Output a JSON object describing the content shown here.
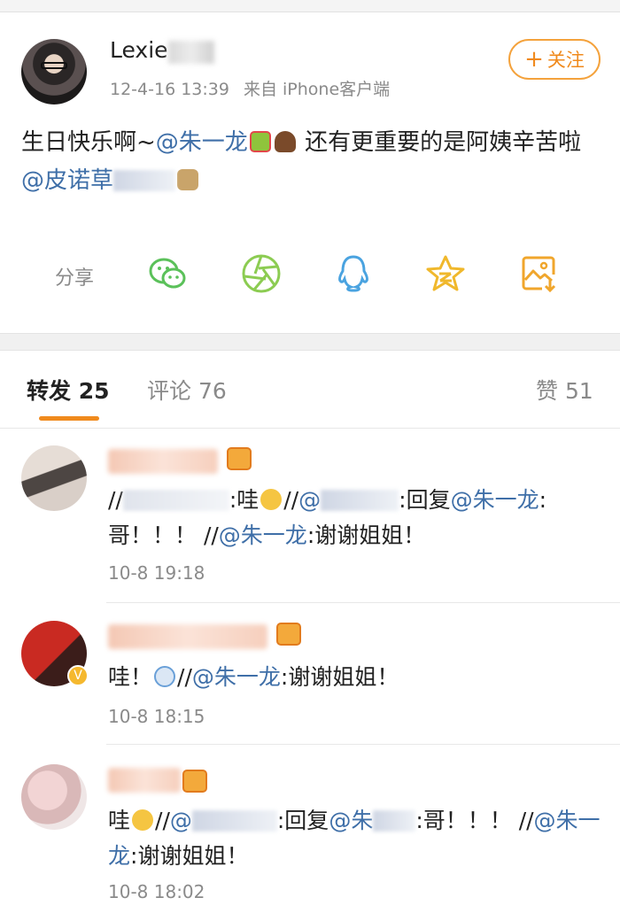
{
  "post": {
    "author": "Lexie",
    "time": "12-4-16 13:39",
    "source": "来自 iPhone客户端",
    "follow_label": "关注",
    "content_part1": "生日快乐啊~",
    "mention1": "@朱一龙",
    "content_part2": " 还有更重要的是阿姨辛苦啦",
    "mention2": "@皮诺草"
  },
  "share": {
    "label": "分享",
    "icons": [
      "wechat-icon",
      "moments-icon",
      "qq-icon",
      "qzone-icon",
      "save-image-icon"
    ]
  },
  "tabs": {
    "repost": "转发 25",
    "comment": "评论 76",
    "like": "赞 51"
  },
  "reposts": [
    {
      "text_a": "//",
      "text_b": ":哇",
      "text_c": "//",
      "mention_a": "@",
      "text_d": ":回复",
      "mention_b": "@朱一龙",
      "text_e": ":哥！！！ //",
      "mention_c": "@朱一龙",
      "text_f": ":谢谢姐姐！",
      "time": "10-8 19:18"
    },
    {
      "text_a": "哇！",
      "text_b": "//",
      "mention_a": "@朱一龙",
      "text_c": ":谢谢姐姐！",
      "time": "10-8 18:15"
    },
    {
      "text_a": "哇",
      "text_b": "//",
      "mention_a": "@",
      "text_c": ":回复",
      "mention_b": "@朱",
      "text_d": ":哥！！！ //",
      "mention_c": "@朱一龙",
      "text_e": ":谢谢姐姐！",
      "time": "10-8 18:02"
    }
  ],
  "colors": {
    "accent": "#f08a1d",
    "link": "#3f6fa8",
    "muted": "#8a8a8a"
  }
}
